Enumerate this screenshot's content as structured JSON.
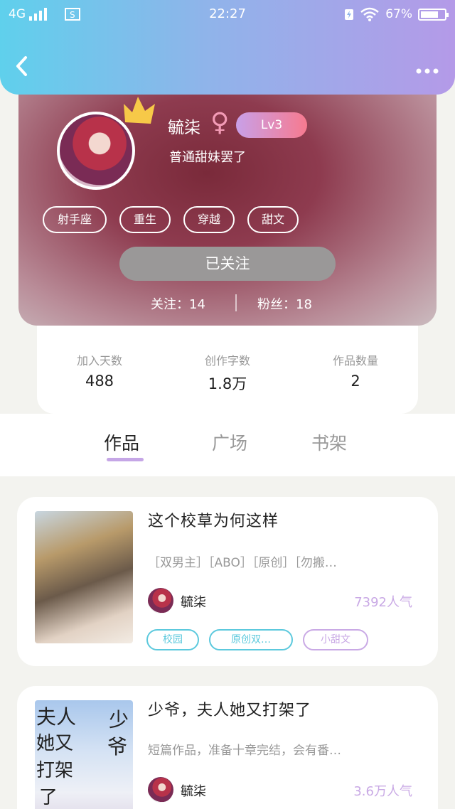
{
  "status_bar": {
    "network": "4G",
    "time": "22:27",
    "battery": "67%"
  },
  "header": {
    "back_icon": "chevron-left-icon",
    "more_icon": "more-dots-icon"
  },
  "profile": {
    "username": "毓柒",
    "gender_symbol": "♀",
    "level": "Lv3",
    "bio": "普通甜妹罢了",
    "tags": [
      "射手座",
      "重生",
      "穿越",
      "甜文"
    ],
    "follow_button": "已关注",
    "following": "关注：14",
    "followers": "粉丝：18"
  },
  "stats": [
    {
      "label": "加入天数",
      "value": "488"
    },
    {
      "label": "创作字数",
      "value": "1.8万"
    },
    {
      "label": "作品数量",
      "value": "2"
    }
  ],
  "tabs": [
    {
      "label": "作品",
      "active": true
    },
    {
      "label": "广场",
      "active": false
    },
    {
      "label": "书架",
      "active": false
    }
  ],
  "works": [
    {
      "title": "这个校草为何这样",
      "desc": "［双男主］［ABO］［原创］［勿搬…",
      "author": "毓柒",
      "popularity": "7392人气",
      "tags": [
        {
          "label": "校园",
          "color": "#5cc9dd"
        },
        {
          "label": "原创双…",
          "color": "#5cc9dd"
        },
        {
          "label": "小甜文",
          "color": "#c9a9e5"
        }
      ]
    },
    {
      "title": "少爷，夫人她又打架了",
      "desc": "短篇作品，准备十章完结，会有番…",
      "author": "毓柒",
      "popularity": "3.6万人气",
      "cover_text": [
        "夫人",
        "少",
        "她又",
        "爷",
        "打架",
        "了"
      ]
    }
  ],
  "colors": {
    "header_start": "#5fd0ec",
    "header_end": "#b49ae8",
    "accent_purple": "#c5a6e6",
    "cyan_tag": "#5cc9dd"
  }
}
